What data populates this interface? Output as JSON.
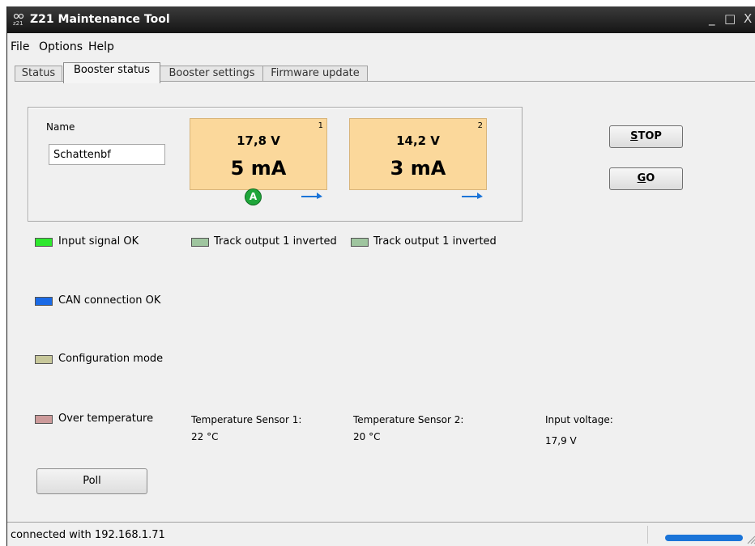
{
  "window": {
    "title": "Z21 Maintenance Tool",
    "controls": [
      "_",
      "□",
      "X"
    ]
  },
  "menu": [
    "File",
    "Options",
    "Help"
  ],
  "tabs": [
    {
      "label": "Status",
      "active": false
    },
    {
      "label": "Booster status",
      "active": true
    },
    {
      "label": "Booster settings",
      "active": false
    },
    {
      "label": "Firmware update",
      "active": false
    }
  ],
  "booster": {
    "name_label": "Name",
    "name_value": "Schattenbf",
    "outputs": [
      {
        "number": "1",
        "voltage": "17,8 V",
        "current": "5 mA"
      },
      {
        "number": "2",
        "voltage": "14,2 V",
        "current": "3 mA"
      }
    ],
    "badge": "A"
  },
  "buttons": {
    "stop": "STOP",
    "go": "GO",
    "poll": "Poll"
  },
  "indicators": [
    {
      "label": "Input signal OK",
      "color": "#2ee82e"
    },
    {
      "label": "Track output 1 inverted",
      "color": "#9fc59f"
    },
    {
      "label": "Track output 1 inverted",
      "color": "#9fc59f"
    },
    {
      "label": "CAN connection OK",
      "color": "#1a6ae6"
    },
    {
      "label": "Configuration mode",
      "color": "#c7c79a"
    },
    {
      "label": "Over temperature",
      "color": "#cc9a9a"
    }
  ],
  "sensors": {
    "sensor1_label": "Temperature Sensor 1:",
    "sensor1_value": "22 °C",
    "sensor2_label": "Temperature Sensor 2:",
    "sensor2_value": "20 °C",
    "input_voltage_label": "Input voltage:",
    "input_voltage_value": "17,9 V"
  },
  "status": {
    "text": "connected with 192.168.1.71"
  },
  "colors": {
    "output_box": "#fbd89b",
    "accent_blue": "#1a74d8",
    "badge_green": "#1fa63a"
  }
}
